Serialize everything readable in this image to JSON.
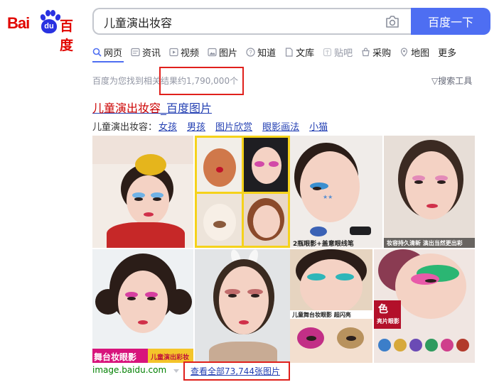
{
  "logo": {
    "text_bai": "Bai",
    "text_du": "du",
    "text_cn": "百度"
  },
  "search": {
    "query": "儿童演出妆容",
    "button_label": "百度一下"
  },
  "tabs": [
    {
      "label": "网页",
      "icon": "search-icon"
    },
    {
      "label": "资讯",
      "icon": "news-icon"
    },
    {
      "label": "视频",
      "icon": "video-icon"
    },
    {
      "label": "图片",
      "icon": "image-icon"
    },
    {
      "label": "知道",
      "icon": "question-icon"
    },
    {
      "label": "文库",
      "icon": "document-icon"
    },
    {
      "label": "贴吧",
      "icon": "tieba-icon"
    },
    {
      "label": "采购",
      "icon": "shopping-icon"
    },
    {
      "label": "地图",
      "icon": "map-icon"
    },
    {
      "label": "更多",
      "icon": ""
    }
  ],
  "results": {
    "stats": "百度为您找到相关结果约1,790,000个",
    "tools_label": "搜索工具"
  },
  "result": {
    "title_highlight": "儿童演出妆容",
    "title_rest": "_百度图片",
    "related_label": "儿童演出妆容：",
    "related_links": [
      "女孩",
      "男孩",
      "图片欣赏",
      "眼影画法",
      "小猫"
    ],
    "captions": {
      "c1": "2瓶眼影+盖意眼线笔",
      "c2": "妆容持久清新 演出当然更出彩",
      "c3": "舞台妆眼影",
      "c4": "儿童演出彩妆",
      "c5": "儿童舞台妆眼影 超闪亮",
      "c6": "色",
      "c7": "亮片眼影"
    },
    "source": "image.baidu.com",
    "view_all": "查看全部73,744张图片"
  },
  "colors": {
    "accent": "#4e6ef2",
    "link": "#2440b3",
    "highlight": "#c00",
    "annotation_box": "#e0201c",
    "source_green": "#008000"
  }
}
